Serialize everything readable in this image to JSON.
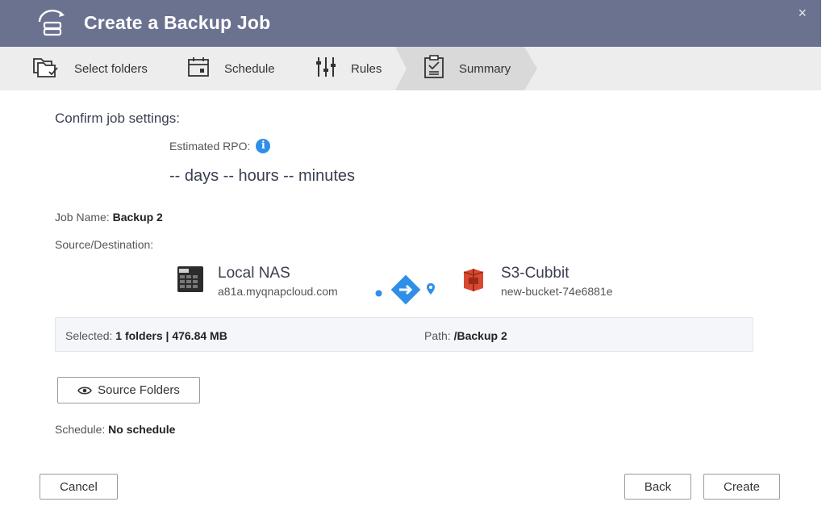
{
  "header": {
    "title": "Create a Backup Job",
    "close_label": "×"
  },
  "steps": [
    {
      "label": "Select folders",
      "icon": "folders-icon"
    },
    {
      "label": "Schedule",
      "icon": "calendar-icon"
    },
    {
      "label": "Rules",
      "icon": "sliders-icon"
    },
    {
      "label": "Summary",
      "icon": "clipboard-check-icon",
      "active": true
    }
  ],
  "content": {
    "confirm_title": "Confirm job settings:",
    "rpo_label": "Estimated RPO:",
    "rpo_value": "-- days -- hours -- minutes",
    "job_name_label": "Job Name:",
    "job_name_value": "Backup 2",
    "source_dest_label": "Source/Destination:",
    "source": {
      "name": "Local NAS",
      "host": "a81a.myqnapcloud.com"
    },
    "destination": {
      "name": "S3-Cubbit",
      "bucket": "new-bucket-74e6881e"
    },
    "selected_label": "Selected:",
    "selected_folders": "1 folders",
    "separator": "|",
    "selected_size": "476.84 MB",
    "path_label": "Path:",
    "path_value": "/Backup 2",
    "source_folders_button": "Source Folders",
    "schedule_label": "Schedule:",
    "schedule_value": "No schedule"
  },
  "footer": {
    "cancel": "Cancel",
    "back": "Back",
    "create": "Create"
  },
  "colors": {
    "header_bg": "#6b7290",
    "accent": "#2f8fe8",
    "s3_red": "#d84a2f"
  }
}
